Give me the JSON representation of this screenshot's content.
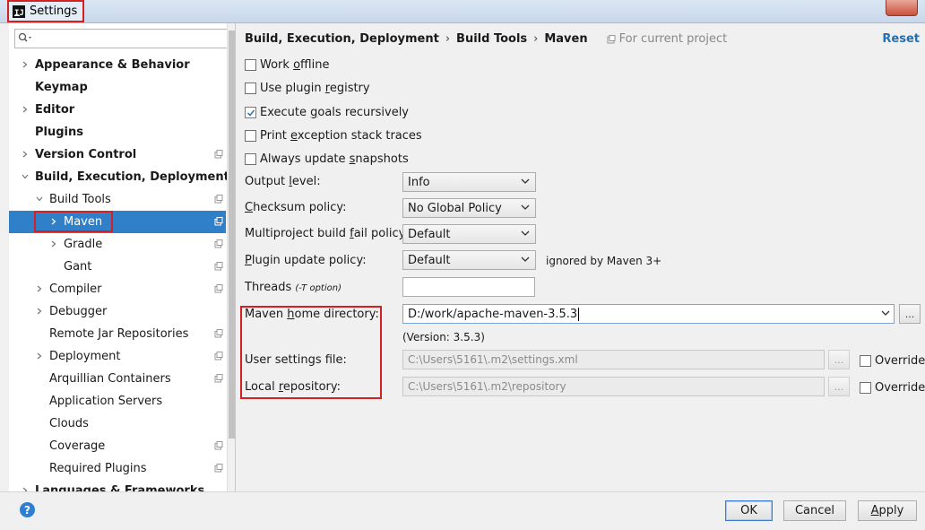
{
  "window": {
    "title": "Settings",
    "icon": "intellij-icon"
  },
  "search": {
    "placeholder": ""
  },
  "sidebar": {
    "items": [
      {
        "label": "Appearance & Behavior",
        "bold": true,
        "arrow": "right",
        "indent": 0,
        "project": false
      },
      {
        "label": "Keymap",
        "bold": true,
        "arrow": "",
        "indent": 0,
        "project": false
      },
      {
        "label": "Editor",
        "bold": true,
        "arrow": "right",
        "indent": 0,
        "project": false
      },
      {
        "label": "Plugins",
        "bold": true,
        "arrow": "",
        "indent": 0,
        "project": false
      },
      {
        "label": "Version Control",
        "bold": true,
        "arrow": "right",
        "indent": 0,
        "project": true
      },
      {
        "label": "Build, Execution, Deployment",
        "bold": true,
        "arrow": "down",
        "indent": 0,
        "project": false
      },
      {
        "label": "Build Tools",
        "bold": false,
        "arrow": "down",
        "indent": 1,
        "project": true
      },
      {
        "label": "Maven",
        "bold": false,
        "arrow": "right",
        "indent": 2,
        "project": true,
        "selected": true
      },
      {
        "label": "Gradle",
        "bold": false,
        "arrow": "right",
        "indent": 2,
        "project": true
      },
      {
        "label": "Gant",
        "bold": false,
        "arrow": "",
        "indent": 2,
        "project": true
      },
      {
        "label": "Compiler",
        "bold": false,
        "arrow": "right",
        "indent": 1,
        "project": true
      },
      {
        "label": "Debugger",
        "bold": false,
        "arrow": "right",
        "indent": 1,
        "project": false
      },
      {
        "label": "Remote Jar Repositories",
        "bold": false,
        "arrow": "",
        "indent": 1,
        "project": true
      },
      {
        "label": "Deployment",
        "bold": false,
        "arrow": "right",
        "indent": 1,
        "project": true
      },
      {
        "label": "Arquillian Containers",
        "bold": false,
        "arrow": "",
        "indent": 1,
        "project": true
      },
      {
        "label": "Application Servers",
        "bold": false,
        "arrow": "",
        "indent": 1,
        "project": false
      },
      {
        "label": "Clouds",
        "bold": false,
        "arrow": "",
        "indent": 1,
        "project": false
      },
      {
        "label": "Coverage",
        "bold": false,
        "arrow": "",
        "indent": 1,
        "project": true
      },
      {
        "label": "Required Plugins",
        "bold": false,
        "arrow": "",
        "indent": 1,
        "project": true
      },
      {
        "label": "Languages & Frameworks",
        "bold": true,
        "arrow": "right",
        "indent": 0,
        "project": false
      }
    ]
  },
  "breadcrumb": {
    "parts": [
      "Build, Execution, Deployment",
      "Build Tools",
      "Maven"
    ],
    "separator": "›",
    "scope": "For current project"
  },
  "reset_label": "Reset",
  "checkboxes": [
    {
      "pre": "Work ",
      "mnemonic": "o",
      "post": "ffline",
      "checked": false
    },
    {
      "pre": "Use plugin ",
      "mnemonic": "r",
      "post": "egistry",
      "checked": false
    },
    {
      "pre": "Execute ",
      "mnemonic": "g",
      "post": "oals recursively",
      "checked": true
    },
    {
      "pre": "Print ",
      "mnemonic": "e",
      "post": "xception stack traces",
      "checked": false
    },
    {
      "pre": "Always update ",
      "mnemonic": "s",
      "post": "napshots",
      "checked": false
    }
  ],
  "fields": {
    "output_level": {
      "pre": "Output ",
      "mnemonic": "l",
      "post": "evel:",
      "value": "Info"
    },
    "checksum": {
      "pre": "",
      "mnemonic": "C",
      "post": "hecksum policy:",
      "value": "No Global Policy"
    },
    "fail_policy": {
      "pre": "Multiproject build ",
      "mnemonic": "f",
      "post": "ail policy:",
      "value": "Default"
    },
    "plugin_update": {
      "pre": "",
      "mnemonic": "P",
      "post": "lugin update policy:",
      "value": "Default",
      "note": "ignored by Maven 3+"
    },
    "threads": {
      "label": "Threads",
      "hint": "(-T option)",
      "value": ""
    },
    "maven_home": {
      "pre": "Maven ",
      "mnemonic": "h",
      "post": "ome directory:",
      "value": "D:/work/apache-maven-3.5.3",
      "version": "(Version: 3.5.3)"
    },
    "user_settings": {
      "label": "User settings file:",
      "value": "C:\\Users\\5161\\.m2\\settings.xml",
      "override": "Override"
    },
    "local_repo": {
      "pre": "Local ",
      "mnemonic": "r",
      "post": "epository:",
      "value": "C:\\Users\\5161\\.m2\\repository",
      "override": "Override"
    },
    "browse_label": "..."
  },
  "buttons": {
    "ok": "OK",
    "cancel": "Cancel",
    "apply_pre": "",
    "apply_mnemonic": "A",
    "apply_post": "pply",
    "help": "?"
  },
  "colors": {
    "selection": "#2f80c8",
    "highlight_box": "#d32020",
    "link": "#2470b3"
  }
}
